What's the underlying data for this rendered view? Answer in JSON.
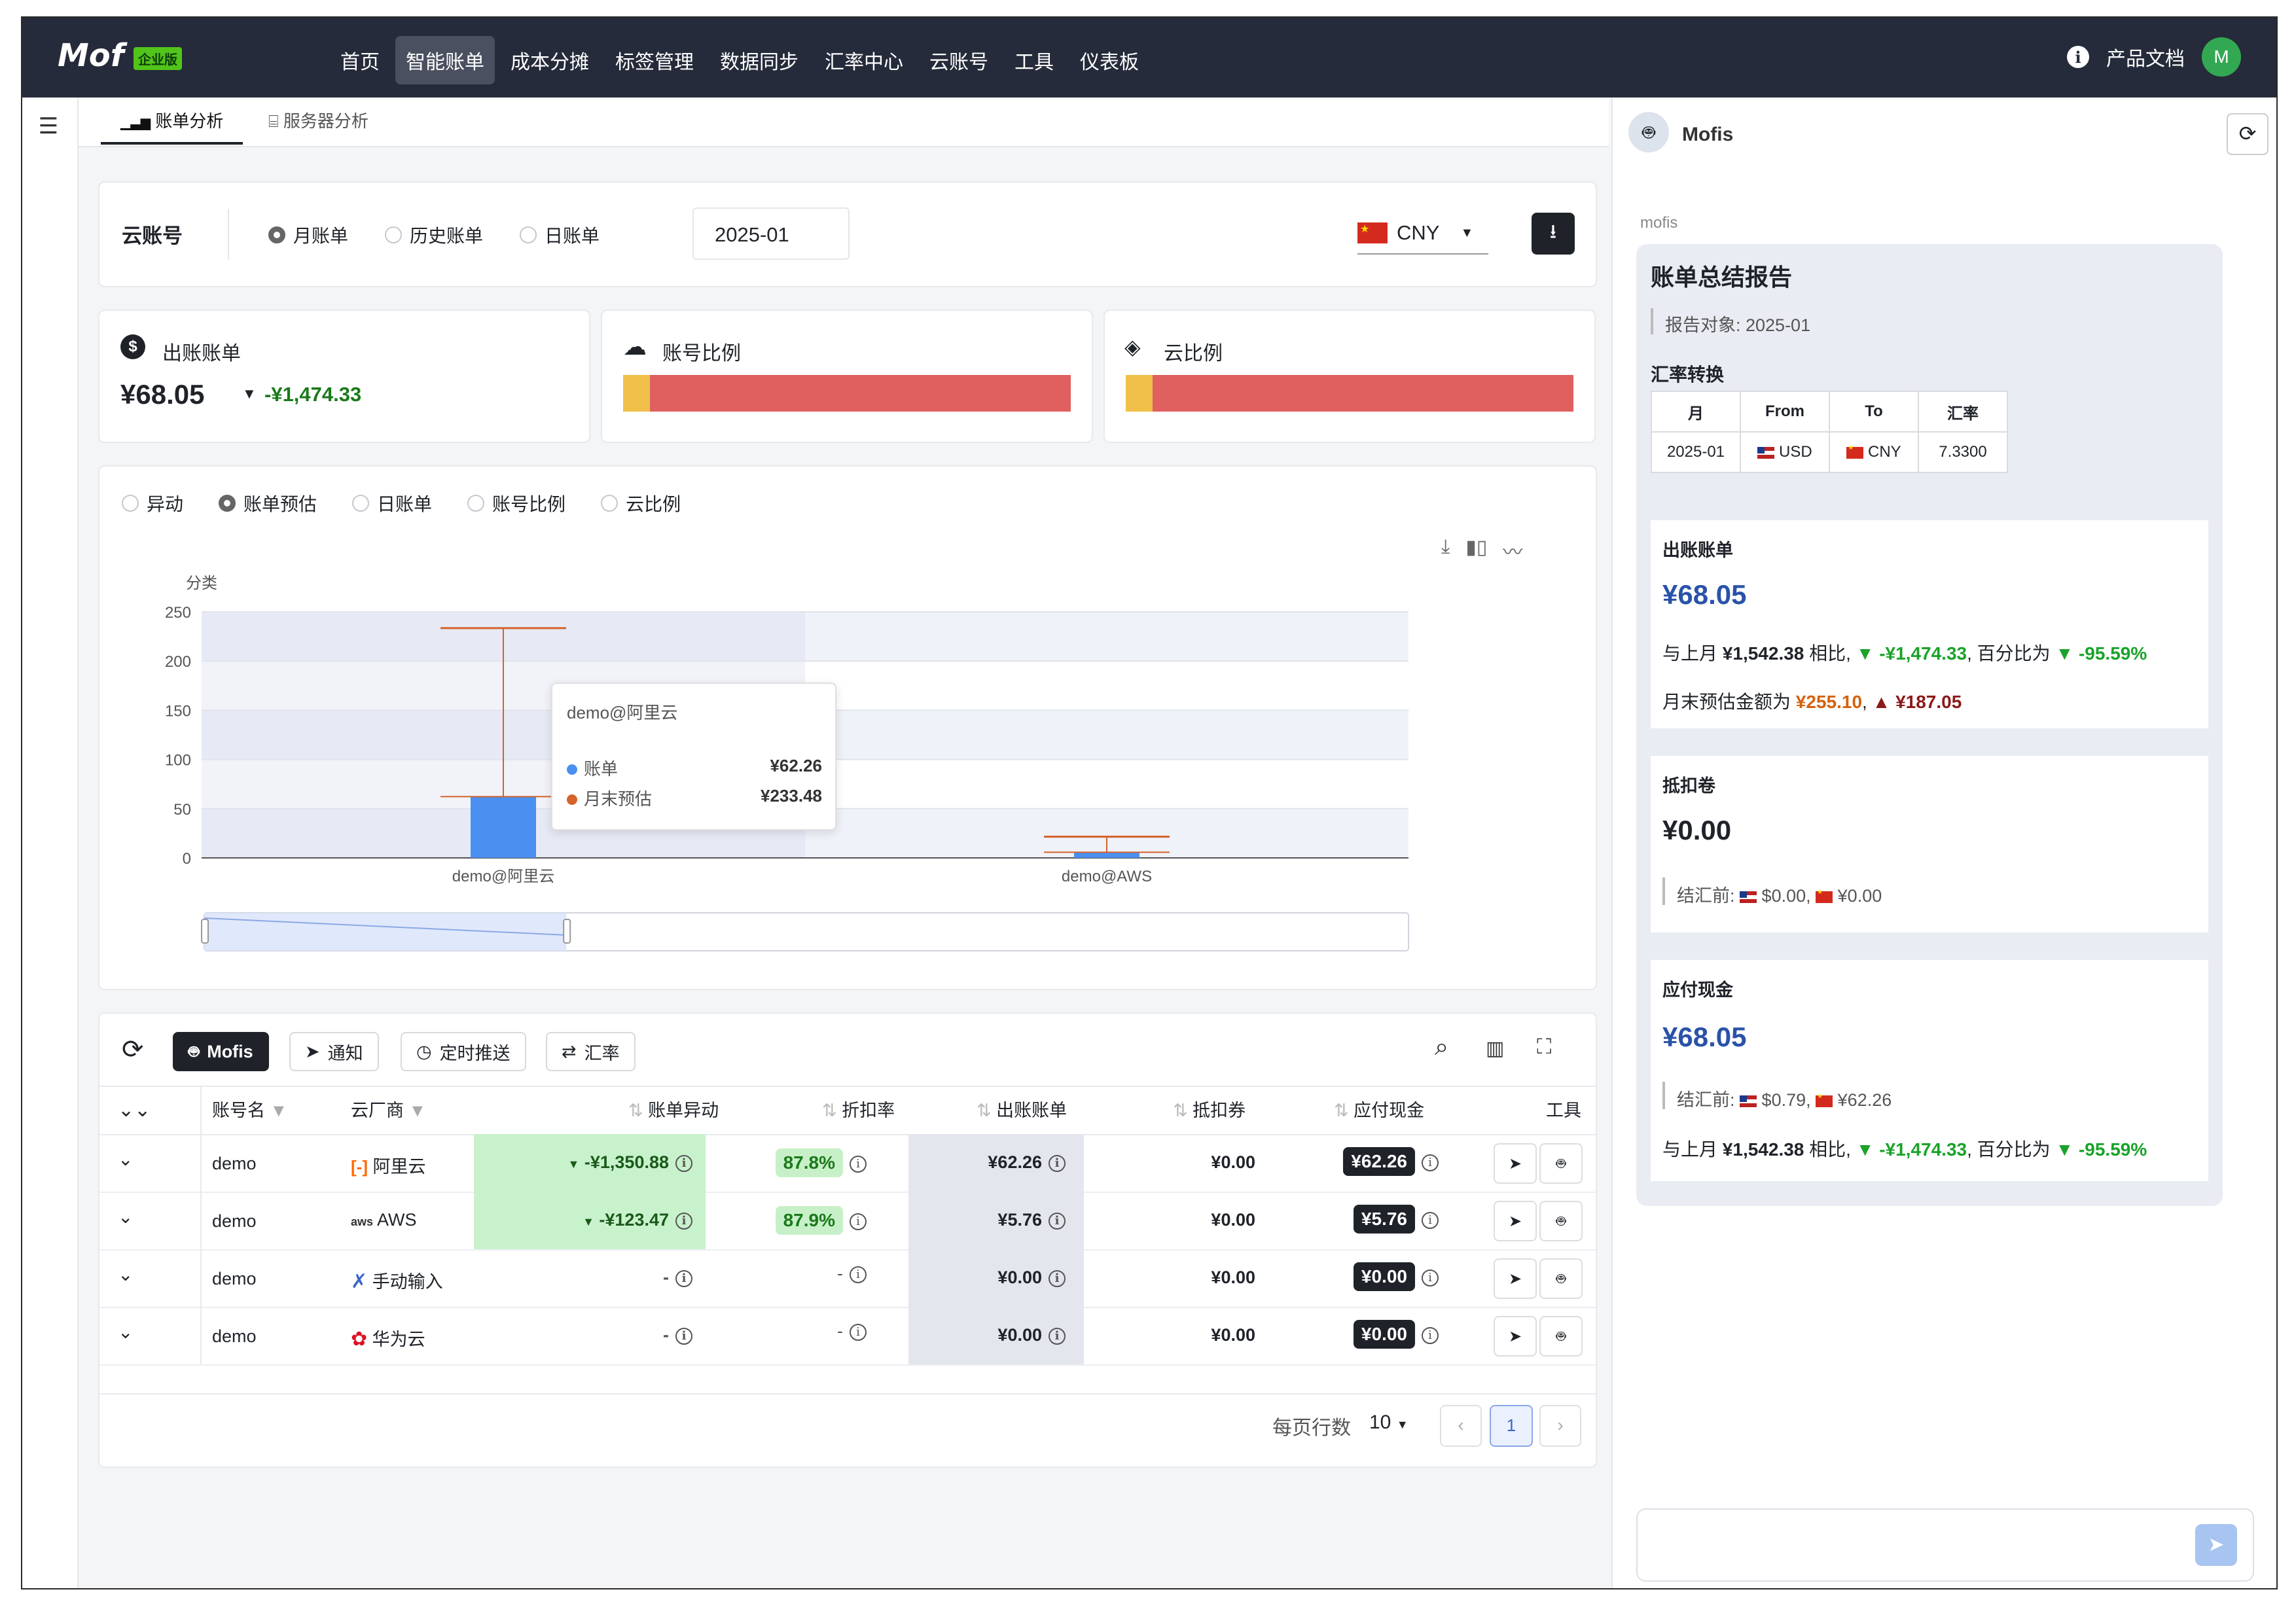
{
  "app": {
    "logo": "Mof",
    "badge": "企业版"
  },
  "nav": {
    "items": [
      "首页",
      "智能账单",
      "成本分摊",
      "标签管理",
      "数据同步",
      "汇率中心",
      "云账号",
      "工具",
      "仪表板"
    ],
    "active_index": 1
  },
  "top_right": {
    "docs": "产品文档",
    "avatar": "M"
  },
  "tabs": [
    "账单分析",
    "服务器分析"
  ],
  "filter": {
    "label": "云账号",
    "radios": [
      "月账单",
      "历史账单",
      "日账单"
    ],
    "selected": "月账单",
    "month": "2025-01",
    "currency": "CNY"
  },
  "stats": {
    "billed": {
      "label": "出账账单",
      "amount": "¥68.05",
      "change": "-¥1,474.33"
    },
    "account_ratio": {
      "label": "账号比例",
      "share": 0.06
    },
    "cloud_ratio": {
      "label": "云比例",
      "share": 0.06
    }
  },
  "chart_radios": [
    "异动",
    "账单预估",
    "日账单",
    "账号比例",
    "云比例"
  ],
  "chart_selected": "账单预估",
  "chart_data": {
    "type": "bar",
    "ylabel": "分类",
    "ylim": [
      0,
      250
    ],
    "yticks": [
      0,
      50,
      100,
      150,
      200,
      250
    ],
    "categories": [
      "demo@阿里云",
      "demo@AWS"
    ],
    "series": [
      {
        "name": "账单",
        "values": [
          62.26,
          5.76
        ],
        "color": "#4a90f0"
      },
      {
        "name": "月末预估",
        "values": [
          233.48,
          21.5
        ],
        "color": "#d4622a"
      }
    ],
    "tooltip": {
      "title": "demo@阿里云",
      "rows": [
        [
          "账单",
          "¥62.26"
        ],
        [
          "月末预估",
          "¥233.48"
        ]
      ]
    },
    "grid": true
  },
  "toolbar": {
    "mofis": "Mofis",
    "notify": "通知",
    "schedule": "定时推送",
    "fx": "汇率"
  },
  "table": {
    "headers": [
      "账号名",
      "云厂商",
      "账单异动",
      "折扣率",
      "出账账单",
      "抵扣券",
      "应付现金",
      "工具"
    ],
    "rows": [
      {
        "account": "demo",
        "vendor": "阿里云",
        "change": "-¥1,350.88",
        "discount": "87.8%",
        "billed": "¥62.26",
        "coupon": "¥0.00",
        "cash": "¥62.26"
      },
      {
        "account": "demo",
        "vendor": "AWS",
        "change": "-¥123.47",
        "discount": "87.9%",
        "billed": "¥5.76",
        "coupon": "¥0.00",
        "cash": "¥5.76"
      },
      {
        "account": "demo",
        "vendor": "手动输入",
        "change": "-",
        "discount": "-",
        "billed": "¥0.00",
        "coupon": "¥0.00",
        "cash": "¥0.00"
      },
      {
        "account": "demo",
        "vendor": "华为云",
        "change": "-",
        "discount": "-",
        "billed": "¥0.00",
        "coupon": "¥0.00",
        "cash": "¥0.00"
      }
    ],
    "per_page_label": "每页行数",
    "per_page": "10",
    "page": "1"
  },
  "assistant": {
    "name": "Mofis",
    "sender": "mofis",
    "report_title": "账单总结报告",
    "report_target": "报告对象: 2025-01",
    "fx_title": "汇率转换",
    "fx_headers": [
      "月",
      "From",
      "To",
      "汇率"
    ],
    "fx_row": [
      "2025-01",
      "USD",
      "CNY",
      "7.3300"
    ],
    "billed": {
      "title": "出账账单",
      "amount": "¥68.05",
      "prev_prefix": "与上月",
      "prev_amount": "¥1,542.38",
      "prev_mid": "相比,",
      "delta": "▼ -¥1,474.33",
      "pct_prefix": ", 百分比为",
      "pct": "▼ -95.59%",
      "forecast_prefix": "月末预估金额为",
      "forecast": "¥255.10",
      "forecast_sep": ",",
      "forecast_delta": "▲ ¥187.05"
    },
    "coupon": {
      "title": "抵扣卷",
      "amount": "¥0.00",
      "before_label": "结汇前:",
      "usd": "$0.00,",
      "cny": "¥0.00"
    },
    "cash": {
      "title": "应付现金",
      "amount": "¥68.05",
      "before_label": "结汇前:",
      "usd": "$0.79,",
      "cny": "¥62.26",
      "prev_prefix": "与上月",
      "prev_amount": "¥1,542.38",
      "prev_mid": "相比,",
      "delta": "▼ -¥1,474.33",
      "pct_prefix": ", 百分比为",
      "pct": "▼ -95.59%"
    }
  }
}
